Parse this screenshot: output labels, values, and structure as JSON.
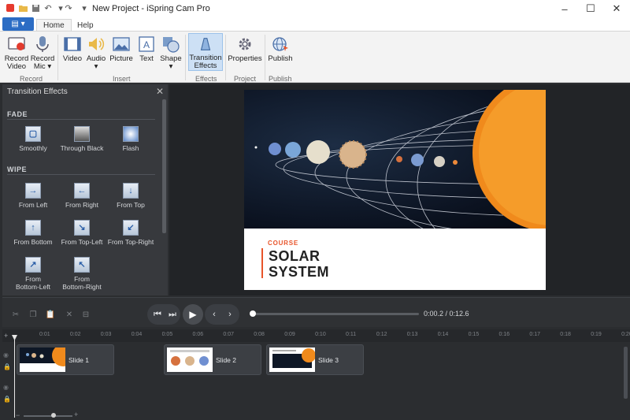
{
  "window": {
    "title": "New Project - iSpring Cam Pro",
    "controls": [
      "minimize",
      "maximize",
      "close"
    ]
  },
  "quick_access": [
    "open-folder-icon",
    "save-icon",
    "undo-icon",
    "redo-icon",
    "customize-icon"
  ],
  "ribbon": {
    "file_button_icon": "file-menu-icon",
    "tabs": [
      {
        "label": "Home",
        "active": true
      },
      {
        "label": "Help",
        "active": false
      }
    ],
    "groups": [
      {
        "label": "Record",
        "buttons": [
          {
            "label": "Record\nVideo",
            "icon": "record-video-icon"
          },
          {
            "label": "Record\nMic",
            "icon": "microphone-icon"
          }
        ]
      },
      {
        "label": "Insert",
        "buttons": [
          {
            "label": "Video",
            "icon": "film-icon"
          },
          {
            "label": "Audio",
            "icon": "speaker-icon"
          },
          {
            "label": "Picture",
            "icon": "picture-icon"
          },
          {
            "label": "Text",
            "icon": "text-icon"
          },
          {
            "label": "Shape",
            "icon": "shape-icon"
          }
        ]
      },
      {
        "label": "Effects",
        "buttons": [
          {
            "label": "Transition\nEffects",
            "icon": "transition-icon",
            "active": true
          }
        ]
      },
      {
        "label": "Project",
        "buttons": [
          {
            "label": "Properties",
            "icon": "gear-icon"
          }
        ]
      },
      {
        "label": "Publish",
        "buttons": [
          {
            "label": "Publish",
            "icon": "globe-icon"
          }
        ]
      }
    ]
  },
  "panel": {
    "title": "Transition Effects",
    "sections": [
      {
        "label": "FADE",
        "items": [
          "Smoothly",
          "Through Black",
          "Flash"
        ]
      },
      {
        "label": "WIPE",
        "items": [
          "From Left",
          "From Right",
          "From Top",
          "From Bottom",
          "From Top-Left",
          "From Top-Right",
          "From\nBottom-Left",
          "From\nBottom-Right"
        ]
      }
    ]
  },
  "slide": {
    "kicker": "COURSE",
    "title_line1": "SOLAR",
    "title_line2": "SYSTEM"
  },
  "player": {
    "time": "0:00.2 / 0:12.6",
    "progress": 0.016
  },
  "timeline": {
    "ticks": [
      "0:01",
      "0:02",
      "0:03",
      "0:04",
      "0:05",
      "0:06",
      "0:07",
      "0:08",
      "0:09",
      "0:10",
      "0:11",
      "0:12",
      "0:13",
      "0:14",
      "0:15",
      "0:16",
      "0:17",
      "0:18",
      "0:19",
      "0:20"
    ],
    "clips": [
      {
        "label": "Slide 1"
      },
      {
        "label": "Slide 2"
      },
      {
        "label": "Slide 3"
      }
    ]
  }
}
